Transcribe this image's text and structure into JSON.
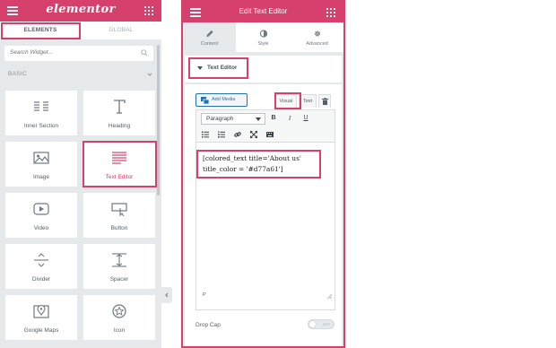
{
  "left_panel": {
    "logo": "elementor",
    "tabs": [
      "ELEMENTS",
      "GLOBAL"
    ],
    "search_placeholder": "Search Widget...",
    "category": "BASIC",
    "widgets": [
      {
        "label": "Inner Section",
        "icon": "columns-icon"
      },
      {
        "label": "Heading",
        "icon": "heading-icon"
      },
      {
        "label": "Image",
        "icon": "image-icon"
      },
      {
        "label": "Text Editor",
        "icon": "text-lines-icon"
      },
      {
        "label": "Video",
        "icon": "video-icon"
      },
      {
        "label": "Button",
        "icon": "button-icon"
      },
      {
        "label": "Divider",
        "icon": "divider-icon"
      },
      {
        "label": "Spacer",
        "icon": "spacer-icon"
      },
      {
        "label": "Google Maps",
        "icon": "map-icon"
      },
      {
        "label": "Icon",
        "icon": "star-icon"
      }
    ]
  },
  "right_panel": {
    "title": "Edit Text Editor",
    "tabs": [
      {
        "label": "Content",
        "icon": "pencil-icon"
      },
      {
        "label": "Style",
        "icon": "half-circle-icon"
      },
      {
        "label": "Advanced",
        "icon": "gear-icon"
      }
    ],
    "section_title": "Text Editor",
    "add_media": "Add Media",
    "editor_tabs": [
      "Visual",
      "Text"
    ],
    "format_select": "Paragraph",
    "toolbar_buttons": [
      "B",
      "I",
      "U"
    ],
    "content_text": "[colored_text title='About us' title_color = '#d77a61']",
    "status_path": "P",
    "drop_cap_label": "Drop Cap",
    "drop_cap_state": "OFF"
  },
  "colors": {
    "brand": "#d5406c",
    "panel_bg": "#e6e9ec",
    "highlight": "#d5406c"
  }
}
